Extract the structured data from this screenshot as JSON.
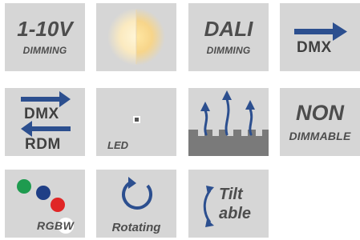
{
  "tiles": {
    "dimming_1_10v": {
      "title": "1-10V",
      "subtitle": "DIMMING"
    },
    "warm_light": {},
    "dali": {
      "title": "DALI",
      "subtitle": "DIMMING"
    },
    "dmx": {
      "label": "DMX"
    },
    "dmx_rdm": {
      "label_top": "DMX",
      "label_bottom": "RDM"
    },
    "led": {
      "label": "LED"
    },
    "heat": {},
    "non_dimmable": {
      "title": "NON",
      "subtitle": "DIMMABLE"
    },
    "rgbw": {
      "label": "RGBW"
    },
    "rotating": {
      "label": "Rotating"
    },
    "tilt": {
      "line1": "Tilt",
      "line2": "able"
    }
  },
  "colors": {
    "tile_bg": "#d6d6d6",
    "text": "#4d4d4d",
    "blue": "#2c4f8f",
    "green": "#1e9b4f",
    "red": "#e02626",
    "dot_blue": "#1f3f86"
  }
}
